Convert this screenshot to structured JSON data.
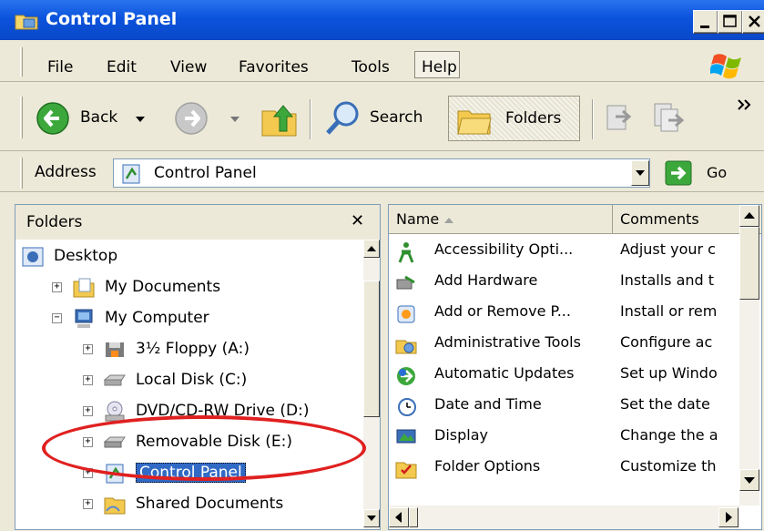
{
  "window": {
    "title": "Control Panel"
  },
  "menu": {
    "items": [
      "File",
      "Edit",
      "View",
      "Favorites",
      "Tools",
      "Help"
    ]
  },
  "toolbar": {
    "back_label": "Back",
    "search_label": "Search",
    "folders_label": "Folders"
  },
  "address": {
    "label": "Address",
    "value": "Control Panel",
    "go_label": "Go"
  },
  "folders_pane": {
    "title": "Folders",
    "close_glyph": "✕"
  },
  "tree": [
    {
      "label": "Desktop",
      "icon": "desktop-icon",
      "expander": ""
    },
    {
      "label": "My Documents",
      "icon": "documents-folder-icon",
      "expander": "+"
    },
    {
      "label": "My Computer",
      "icon": "computer-icon",
      "expander": "−"
    },
    {
      "label": "3½ Floppy (A:)",
      "icon": "floppy-icon",
      "expander": "+"
    },
    {
      "label": "Local Disk (C:)",
      "icon": "hard-disk-icon",
      "expander": "+"
    },
    {
      "label": "DVD/CD-RW Drive (D:)",
      "icon": "optical-drive-icon",
      "expander": "+"
    },
    {
      "label": "Removable Disk (E:)",
      "icon": "removable-disk-icon",
      "expander": "+"
    },
    {
      "label": "Control Panel",
      "icon": "control-panel-icon",
      "expander": "+",
      "selected": true
    },
    {
      "label": "Shared Documents",
      "icon": "shared-folder-icon",
      "expander": "+"
    }
  ],
  "files": {
    "columns": [
      "Name",
      "Comments"
    ],
    "rows": [
      {
        "name": "Accessibility Opti...",
        "comment": "Adjust your c",
        "icon": "accessibility-icon"
      },
      {
        "name": "Add Hardware",
        "comment": "Installs and t",
        "icon": "add-hardware-icon"
      },
      {
        "name": "Add or Remove P...",
        "comment": "Install or rem",
        "icon": "add-remove-programs-icon"
      },
      {
        "name": "Administrative Tools",
        "comment": "Configure ac",
        "icon": "administrative-tools-icon"
      },
      {
        "name": "Automatic Updates",
        "comment": "Set up Windo",
        "icon": "automatic-updates-icon"
      },
      {
        "name": "Date and Time",
        "comment": "Set the date",
        "icon": "date-time-icon"
      },
      {
        "name": "Display",
        "comment": "Change the a",
        "icon": "display-icon"
      },
      {
        "name": "Folder Options",
        "comment": "Customize th",
        "icon": "folder-options-icon"
      }
    ]
  },
  "colors": {
    "titlebar": "#0b53dc",
    "selection": "#316ac5",
    "annotation": "#e02020"
  }
}
